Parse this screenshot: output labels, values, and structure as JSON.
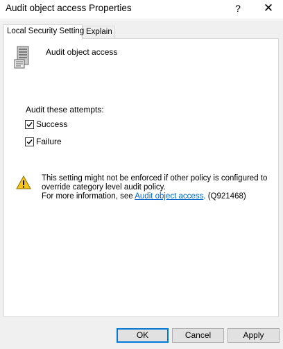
{
  "window": {
    "title": "Audit object access Properties",
    "help_glyph": "?",
    "close_glyph": "✕"
  },
  "tabs": [
    {
      "label": "Local Security Setting",
      "active": true
    },
    {
      "label": "Explain",
      "active": false
    }
  ],
  "policy": {
    "name": "Audit object access",
    "icon": "server-policy-icon"
  },
  "audit": {
    "label": "Audit these attempts:",
    "success": {
      "label": "Success",
      "checked": true
    },
    "failure": {
      "label": "Failure",
      "checked": true
    }
  },
  "warning": {
    "icon": "warning-icon",
    "line1": "This setting might not be enforced if other policy is configured to",
    "line2": "override category level audit policy.",
    "line3_prefix": "For more information, see ",
    "link_text": "Audit object access",
    "line3_suffix": ". (Q921468)"
  },
  "buttons": {
    "ok": "OK",
    "cancel": "Cancel",
    "apply": "Apply"
  },
  "colors": {
    "accent": "#0078d7",
    "link": "#0066cc",
    "warning": "#f5c518"
  }
}
